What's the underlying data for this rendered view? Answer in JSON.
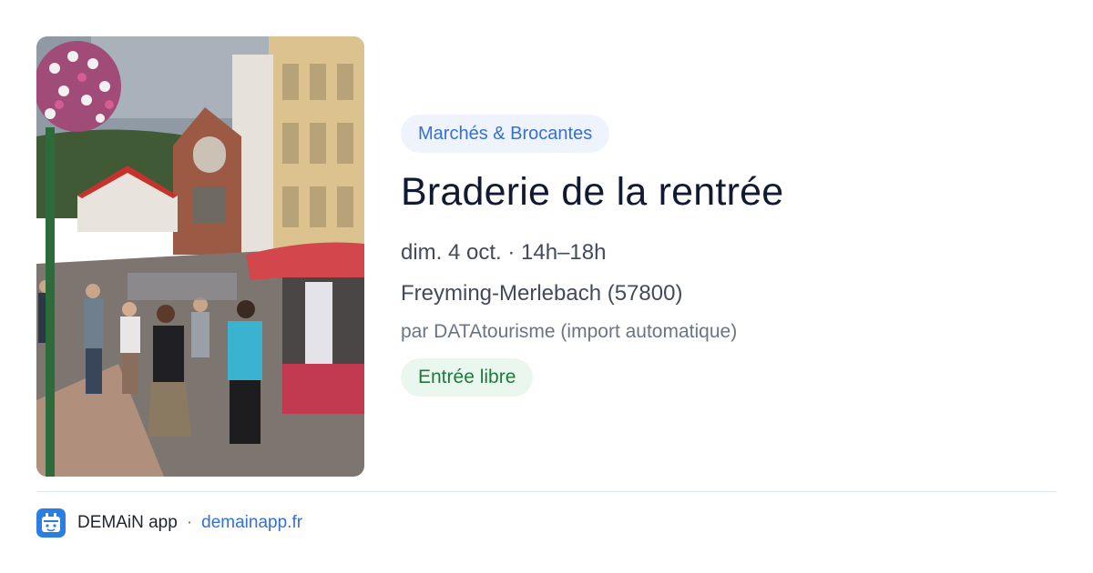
{
  "event": {
    "category": "Marchés & Brocantes",
    "title": "Braderie de la rentrée",
    "datetime": "dim. 4 oct. · 14h–18h",
    "location": "Freyming-Merlebach (57800)",
    "organizer": "par DATAtourisme (import automatique)",
    "price": "Entrée libre",
    "image": "market-street-photo"
  },
  "footer": {
    "app_name": "DEMAiN app",
    "separator": "·",
    "site": "demainapp.fr",
    "icon": "demain-app-icon"
  },
  "colors": {
    "accent": "#3470d6",
    "category_bg": "#eef3fd",
    "price_text": "#1d7a3c",
    "price_bg": "#eaf7ee",
    "app_icon_bg": "#2a7de1"
  }
}
